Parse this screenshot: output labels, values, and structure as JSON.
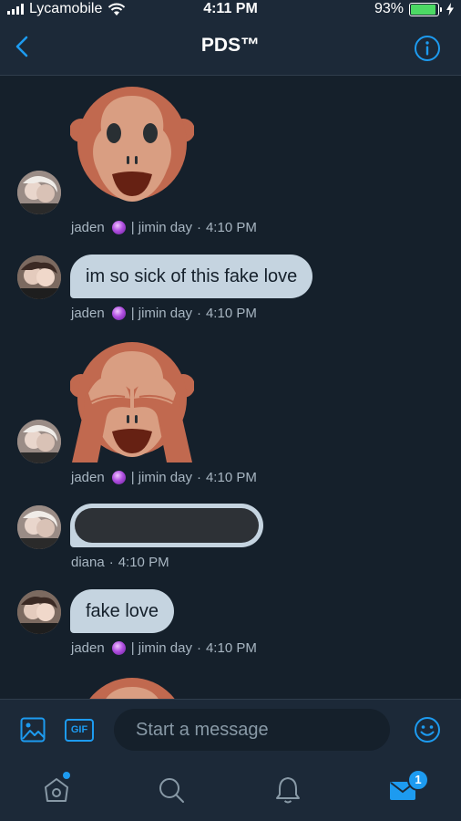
{
  "status_bar": {
    "carrier": "Lycamobile",
    "time": "4:11 PM",
    "battery": "93%",
    "battery_level": 0.93
  },
  "header": {
    "title": "PDS™",
    "back_icon": "chevron-left-icon",
    "info_icon": "info-icon"
  },
  "messages": [
    {
      "type": "emoji",
      "emoji": "monkey-face",
      "sender": "jaden",
      "badge": "crystal-ball-emoji",
      "group": "| jimin day",
      "time": "4:10 PM"
    },
    {
      "type": "text",
      "text": "im so sick of this fake love",
      "sender": "jaden",
      "badge": "crystal-ball-emoji",
      "group": "| jimin day",
      "time": "4:10 PM"
    },
    {
      "type": "emoji",
      "emoji": "see-no-evil-monkey",
      "sender": "jaden",
      "badge": "crystal-ball-emoji",
      "group": "| jimin day",
      "time": "4:10 PM"
    },
    {
      "type": "redacted",
      "sender": "diana",
      "time": "4:10 PM"
    },
    {
      "type": "text",
      "text": "fake love",
      "sender": "jaden",
      "badge": "crystal-ball-emoji",
      "group": "| jimin day",
      "time": "4:10 PM"
    },
    {
      "type": "emoji",
      "emoji": "monkey-face",
      "partial": true
    }
  ],
  "composer": {
    "placeholder": "Start a message",
    "gif_label": "GIF",
    "image_icon": "image-icon",
    "emoji_icon": "smiley-icon"
  },
  "tabbar": {
    "items": [
      "home-icon",
      "search-icon",
      "bell-icon",
      "mail-icon"
    ],
    "mail_badge": "1"
  },
  "colors": {
    "background": "#15202b",
    "bar": "#1c2938",
    "accent": "#1d9bf0",
    "bubble": "#c5d4e0"
  }
}
